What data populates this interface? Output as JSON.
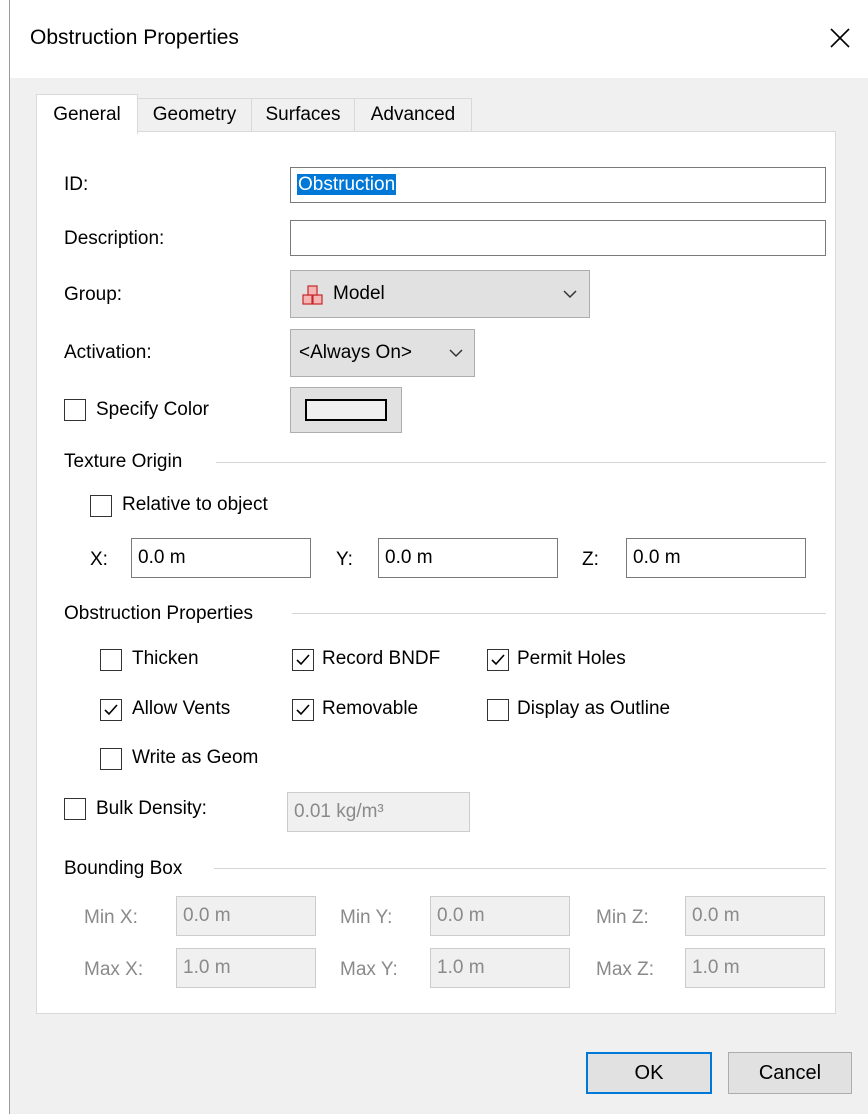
{
  "window": {
    "title": "Obstruction Properties"
  },
  "tabs": [
    {
      "label": "General",
      "active": true
    },
    {
      "label": "Geometry",
      "active": false
    },
    {
      "label": "Surfaces",
      "active": false
    },
    {
      "label": "Advanced",
      "active": false
    }
  ],
  "general": {
    "id_label": "ID:",
    "id_value": "Obstruction",
    "description_label": "Description:",
    "description_value": "",
    "group_label": "Group:",
    "group_value": "Model",
    "group_icon": "model-blocks-icon",
    "activation_label": "Activation:",
    "activation_value": "<Always On>",
    "specify_color_label": "Specify Color",
    "specify_color_checked": false,
    "color_swatch": "#f0f0f0"
  },
  "texture_origin": {
    "heading": "Texture Origin",
    "relative_label": "Relative to object",
    "relative_checked": false,
    "x_label": "X:",
    "x_value": "0.0 m",
    "y_label": "Y:",
    "y_value": "0.0 m",
    "z_label": "Z:",
    "z_value": "0.0 m"
  },
  "obstruction_properties": {
    "heading": "Obstruction Properties",
    "thicken": {
      "label": "Thicken",
      "checked": false
    },
    "record_bndf": {
      "label": "Record BNDF",
      "checked": true
    },
    "permit_holes": {
      "label": "Permit Holes",
      "checked": true
    },
    "allow_vents": {
      "label": "Allow Vents",
      "checked": true
    },
    "removable": {
      "label": "Removable",
      "checked": true
    },
    "display_outline": {
      "label": "Display as Outline",
      "checked": false
    },
    "write_geom": {
      "label": "Write as Geom",
      "checked": false
    }
  },
  "bulk_density": {
    "label": "Bulk Density:",
    "checked": false,
    "value": "0.01 kg/m³"
  },
  "bounding_box": {
    "heading": "Bounding Box",
    "min_x_label": "Min X:",
    "min_x": "0.0 m",
    "min_y_label": "Min Y:",
    "min_y": "0.0 m",
    "min_z_label": "Min Z:",
    "min_z": "0.0 m",
    "max_x_label": "Max X:",
    "max_x": "1.0 m",
    "max_y_label": "Max Y:",
    "max_y": "1.0 m",
    "max_z_label": "Max Z:",
    "max_z": "1.0 m"
  },
  "buttons": {
    "ok": "OK",
    "cancel": "Cancel"
  },
  "colors": {
    "accent": "#0078d7",
    "disabled_text": "#8a8a8a",
    "group_icon": "#d23a3a"
  }
}
